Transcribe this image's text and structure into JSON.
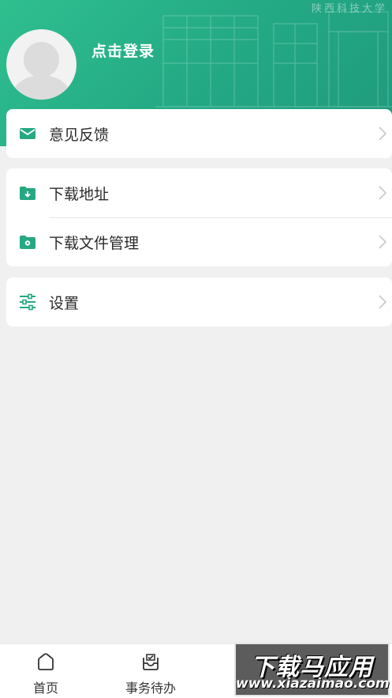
{
  "header": {
    "login_text": "点击登录",
    "script_text": "陕西科技大学",
    "color": "#2ab48c"
  },
  "menu": {
    "feedback": {
      "label": "意见反馈",
      "icon": "mail-icon"
    },
    "download_address": {
      "label": "下载地址",
      "icon": "folder-download-icon"
    },
    "download_manage": {
      "label": "下载文件管理",
      "icon": "folder-gear-icon"
    },
    "settings": {
      "label": "设置",
      "icon": "sliders-icon"
    }
  },
  "tabbar": {
    "home": {
      "label": "首页",
      "icon": "home-icon"
    },
    "tasks": {
      "label": "事务待办",
      "icon": "inbox-check-icon"
    }
  },
  "watermark": {
    "title": "下载马应用",
    "url": "www.xiazaimao.com"
  },
  "colors": {
    "accent": "#26a883",
    "chevron": "#c8c8c8"
  }
}
